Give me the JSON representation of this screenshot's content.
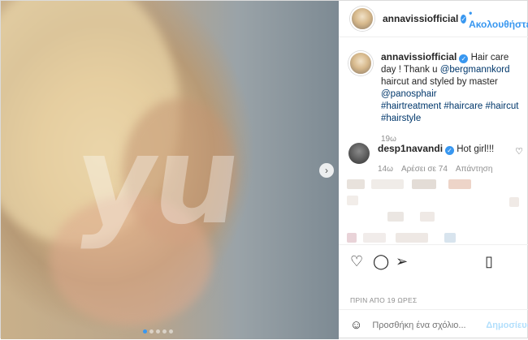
{
  "post": {
    "username": "annavissiofficial",
    "follow_label": "Ακολουθήστε",
    "watermark": "yu",
    "caption": {
      "text": "Hair care day ! Thank u",
      "mention1": "@bergmannkord",
      "text2": "haircut and styled by master",
      "mention2": "@panosphair",
      "tags": [
        "#hairtreatment",
        "#haircare",
        "#haircut",
        "#hairstyle"
      ],
      "time": "19ω"
    },
    "comment": {
      "username": "desp1navandi",
      "text": "Hot girl!!!",
      "time": "14ω",
      "likes": "Αρέσει σε 74",
      "reply": "Απάντηση"
    },
    "date": "ΠΡΙΝ ΑΠΟ 19 ΩΡΕΣ",
    "composer": {
      "placeholder": "Προσθήκη ένα σχόλιο...",
      "publish": "Δημοσίευση"
    }
  },
  "icons": [
    "verified-badge-icon",
    "heart-icon",
    "comment-icon",
    "share-icon",
    "bookmark-icon",
    "emoji-icon",
    "next-arrow-icon"
  ],
  "colors": {
    "accent": "#3897f0",
    "link": "#00376b",
    "muted": "#8e8e8e"
  }
}
